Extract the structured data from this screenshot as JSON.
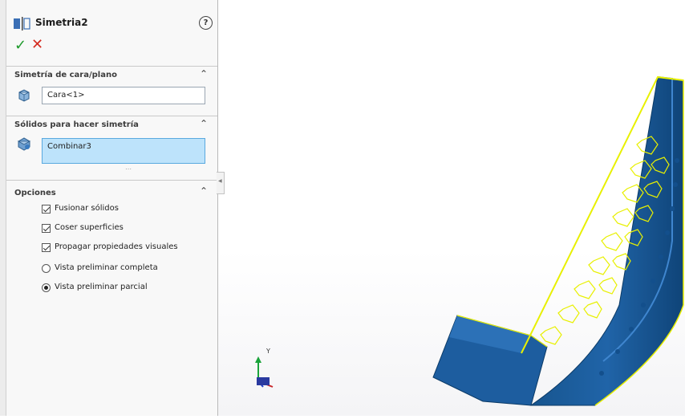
{
  "property_manager": {
    "title": "Simetria2",
    "ok_symbol": "✓",
    "cancel_symbol": "✕",
    "help_symbol": "?",
    "mirror_face_section": {
      "title": "Simetría de cara/plano",
      "value": "Cara<1>"
    },
    "bodies_section": {
      "title": "Sólidos para hacer simetría",
      "value": "Combinar3"
    },
    "options_section": {
      "title": "Opciones",
      "options": [
        {
          "label": "Fusionar sólidos",
          "type": "checkbox",
          "checked": true
        },
        {
          "label": "Coser superficies",
          "type": "checkbox",
          "checked": true
        },
        {
          "label": "Propagar propiedades visuales",
          "type": "checkbox",
          "checked": true
        },
        {
          "label": "Vista preliminar completa",
          "type": "radio",
          "checked": false
        },
        {
          "label": "Vista preliminar parcial",
          "type": "radio",
          "checked": true
        }
      ]
    }
  },
  "viewport": {
    "triad_axis_label": "Y",
    "model_color": "#1f5fa8",
    "highlight_color": "#e8f000"
  }
}
